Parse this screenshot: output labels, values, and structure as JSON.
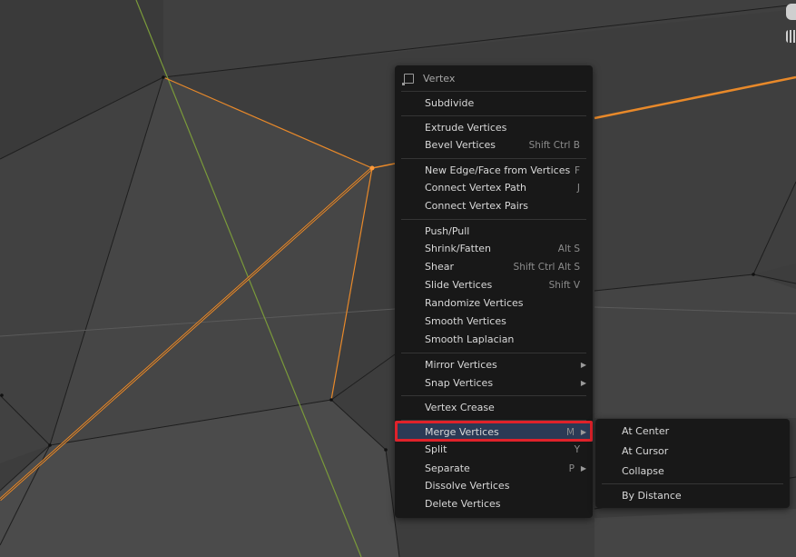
{
  "menu": {
    "title": "Vertex",
    "items": [
      {
        "label": "Subdivide",
        "shortcut": ""
      },
      {
        "label": "Extrude Vertices",
        "shortcut": ""
      },
      {
        "label": "Bevel Vertices",
        "shortcut": "Shift Ctrl B"
      },
      {
        "label": "New Edge/Face from Vertices",
        "shortcut": "F"
      },
      {
        "label": "Connect Vertex Path",
        "shortcut": "J"
      },
      {
        "label": "Connect Vertex Pairs",
        "shortcut": ""
      },
      {
        "label": "Push/Pull",
        "shortcut": ""
      },
      {
        "label": "Shrink/Fatten",
        "shortcut": "Alt S"
      },
      {
        "label": "Shear",
        "shortcut": "Shift Ctrl Alt S"
      },
      {
        "label": "Slide Vertices",
        "shortcut": "Shift V"
      },
      {
        "label": "Randomize Vertices",
        "shortcut": ""
      },
      {
        "label": "Smooth Vertices",
        "shortcut": ""
      },
      {
        "label": "Smooth Laplacian",
        "shortcut": ""
      },
      {
        "label": "Mirror Vertices",
        "shortcut": ""
      },
      {
        "label": "Snap Vertices",
        "shortcut": ""
      },
      {
        "label": "Vertex Crease",
        "shortcut": ""
      },
      {
        "label": "Merge Vertices",
        "shortcut": "M"
      },
      {
        "label": "Split",
        "shortcut": "Y"
      },
      {
        "label": "Separate",
        "shortcut": "P"
      },
      {
        "label": "Dissolve Vertices",
        "shortcut": ""
      },
      {
        "label": "Delete Vertices",
        "shortcut": ""
      }
    ]
  },
  "submenu": {
    "items": [
      {
        "label": "At Center"
      },
      {
        "label": "At Cursor"
      },
      {
        "label": "Collapse"
      },
      {
        "label": "By Distance"
      }
    ]
  },
  "icons": {
    "menu_header": "vertex-select-icon",
    "top_right_1": "camera-icon",
    "top_right_2": "grid-icon"
  },
  "colors": {
    "viewport_background": "#3d3d3d",
    "menu_background": "#181818",
    "selected_edge": "#e8892a",
    "y_axis": "#7a9a3a",
    "highlight_border": "#e0222a"
  }
}
